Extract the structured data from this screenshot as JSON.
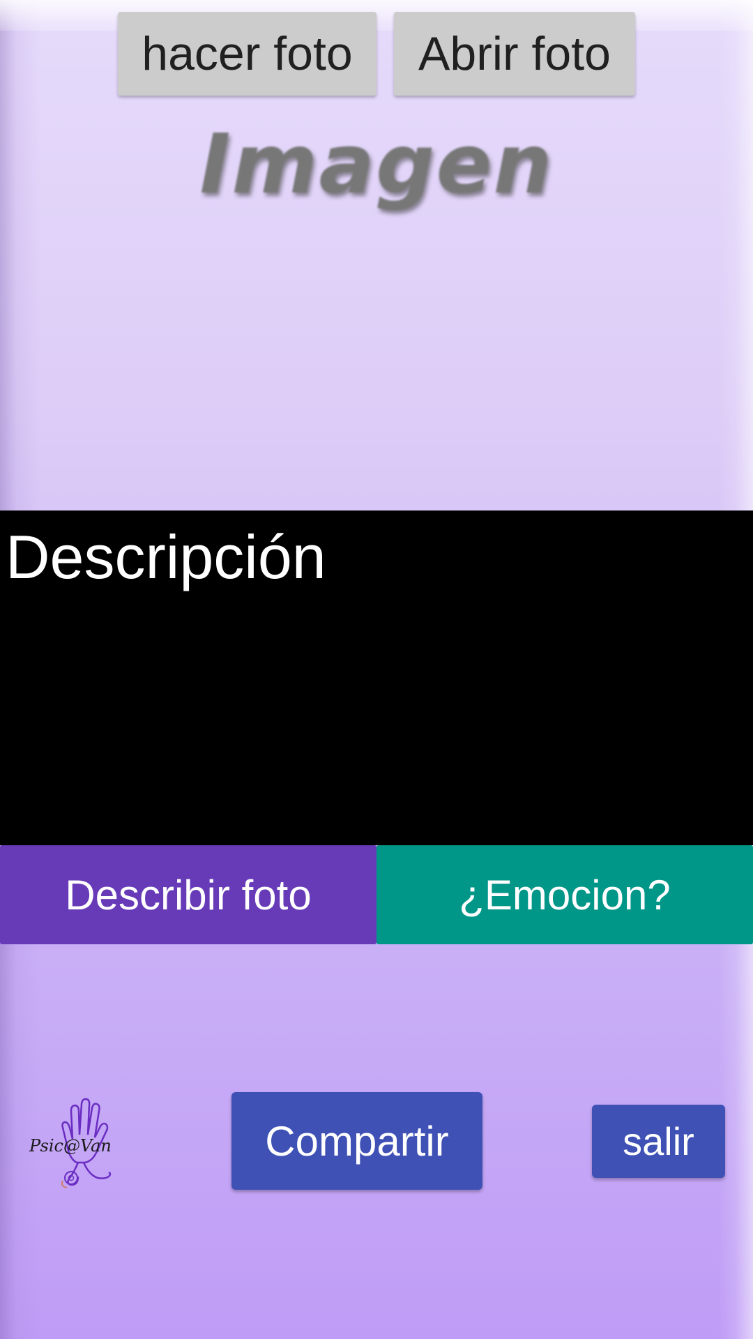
{
  "top_buttons": {
    "take_photo": "hacer foto",
    "open_photo": "Abrir foto"
  },
  "image_placeholder": {
    "text": "Imagen"
  },
  "description": {
    "text": "Descripción"
  },
  "action_buttons": {
    "describe": {
      "label": "Describir foto",
      "color": "#673ab7"
    },
    "emotion": {
      "label": "¿Emocion?",
      "color": "#009688"
    }
  },
  "bottom_bar": {
    "logo_text": "Psic@Van",
    "share_label": "Compartir",
    "exit_label": "salir",
    "button_color": "#3f51b5"
  },
  "colors": {
    "background_top": "#e6dbfb",
    "background_bottom": "#bf9cf6",
    "description_bg": "#000000",
    "gray_button": "#cccccc"
  }
}
